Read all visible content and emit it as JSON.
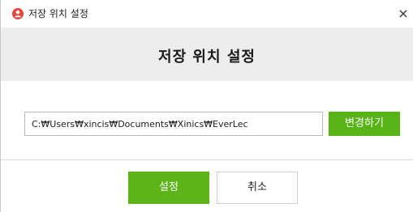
{
  "window": {
    "title": "저장 위치 설정",
    "close_glyph": "×",
    "icon": "user-circle-icon"
  },
  "dialog": {
    "heading": "저장 위치 설정"
  },
  "path": {
    "value": "C:₩Users₩xincis₩Documents₩Xinics₩EverLec"
  },
  "buttons": {
    "change_label": "변경하기",
    "confirm_label": "설정",
    "cancel_label": "취소"
  },
  "colors": {
    "accent_green": "#5cb418",
    "app_icon_red": "#e8453c",
    "header_gray": "#ededed"
  }
}
